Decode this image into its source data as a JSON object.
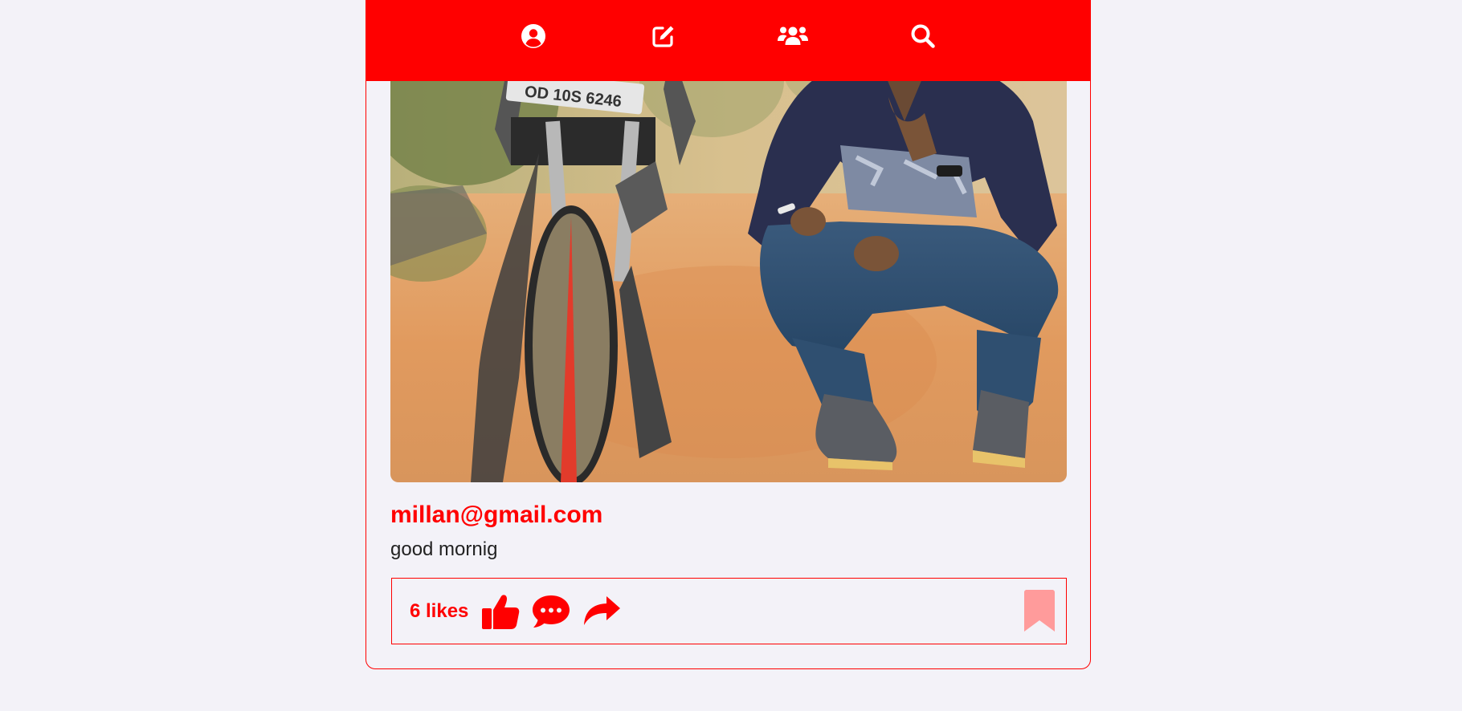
{
  "colors": {
    "accent": "#ff0000",
    "page_background": "#f3f2f8",
    "bookmark": "#ff9b9b",
    "caption_text": "#222222"
  },
  "nav": {
    "items": [
      {
        "icon": "user-circle-icon"
      },
      {
        "icon": "edit-icon"
      },
      {
        "icon": "users-icon"
      },
      {
        "icon": "search-icon"
      }
    ]
  },
  "post": {
    "image": {
      "icon": "photo-man-with-motorcycle",
      "plate_text": "OD 10S 6246"
    },
    "author": "millan@gmail.com",
    "caption": "good mornig",
    "likes_label": "6 likes",
    "actions": [
      {
        "icon": "thumbs-up-icon"
      },
      {
        "icon": "comment-icon"
      },
      {
        "icon": "share-icon"
      }
    ],
    "bookmark_icon": "bookmark-icon"
  }
}
